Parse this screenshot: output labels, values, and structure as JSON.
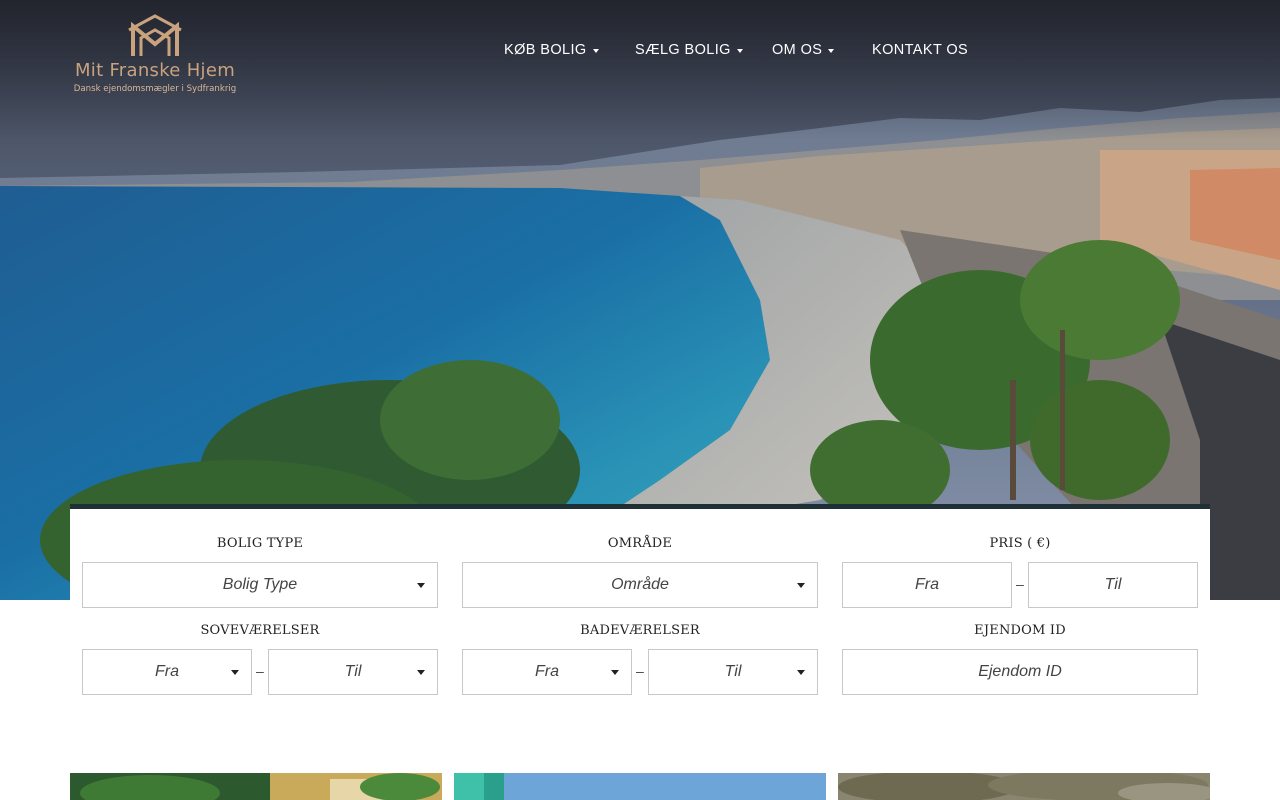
{
  "logo": {
    "brand": "Mit Franske Hjem",
    "tagline": "Dansk ejendomsmægler i Sydfrankrig"
  },
  "nav": {
    "items": [
      {
        "label": "KØB BOLIG",
        "has_dropdown": true
      },
      {
        "label": "SÆLG BOLIG",
        "has_dropdown": true
      },
      {
        "label": "OM OS",
        "has_dropdown": true
      },
      {
        "label": "KONTAKT OS",
        "has_dropdown": false
      }
    ]
  },
  "search": {
    "property_type": {
      "label": "BOLIG TYPE",
      "value": "Bolig Type"
    },
    "area": {
      "label": "OMRÅDE",
      "value": "Område"
    },
    "price": {
      "label": "PRIS ( €)",
      "from_placeholder": "Fra",
      "to_placeholder": "Til"
    },
    "bedrooms": {
      "label": "SOVEVÆRELSER",
      "from_value": "Fra",
      "to_value": "Til"
    },
    "bathrooms": {
      "label": "BADEVÆRELSER",
      "from_value": "Fra",
      "to_value": "Til"
    },
    "property_id": {
      "label": "EJENDOM ID",
      "placeholder": "Ejendom ID"
    },
    "range_separator": "–"
  },
  "colors": {
    "panel_border": "#1f3136",
    "logo_gold": "#c9a27e",
    "field_border": "#c8c8c8"
  }
}
